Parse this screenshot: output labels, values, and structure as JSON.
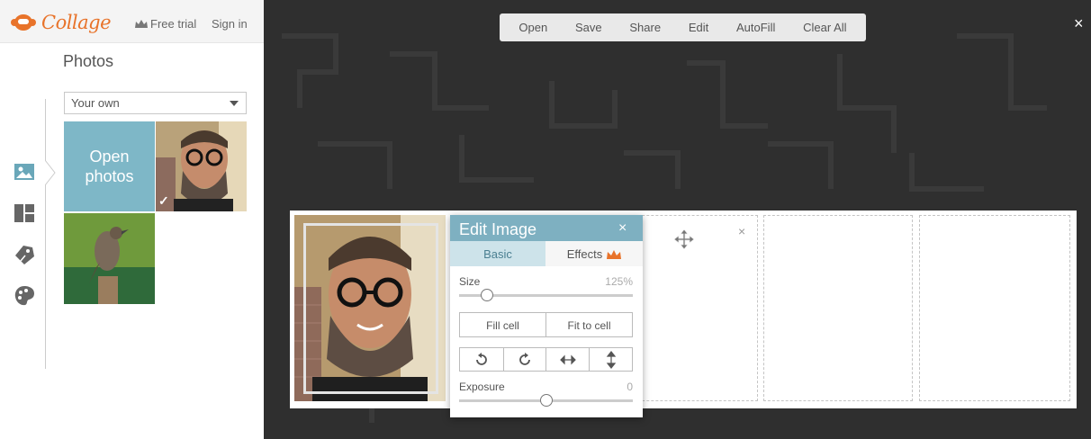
{
  "header": {
    "logo_text": "Collage",
    "free_trial_label": "Free trial",
    "sign_in_label": "Sign in"
  },
  "sidebar": {
    "title": "Photos",
    "source_select_value": "Your own",
    "open_photos_line1": "Open",
    "open_photos_line2": "photos",
    "rail_icons": [
      "image-icon",
      "layout-icon",
      "stickers-icon",
      "palette-icon"
    ]
  },
  "menu": {
    "items": [
      "Open",
      "Save",
      "Share",
      "Edit",
      "AutoFill",
      "Clear All"
    ],
    "close_label": "×"
  },
  "collage": {
    "cell_close_label": "×"
  },
  "edit_image": {
    "title": "Edit Image",
    "close_label": "×",
    "tab_basic": "Basic",
    "tab_effects": "Effects",
    "size_label": "Size",
    "size_value": "125%",
    "size_slider_fraction": 0.16,
    "fill_cell_label": "Fill cell",
    "fit_to_cell_label": "Fit to cell",
    "exposure_label": "Exposure",
    "exposure_value": "0",
    "exposure_slider_fraction": 0.5
  },
  "colors": {
    "accent_orange": "#e8732a",
    "panel_blue": "#7eb0c1",
    "open_photos_blue": "#7eb7c7",
    "stage_dark": "#2f2f2f"
  }
}
